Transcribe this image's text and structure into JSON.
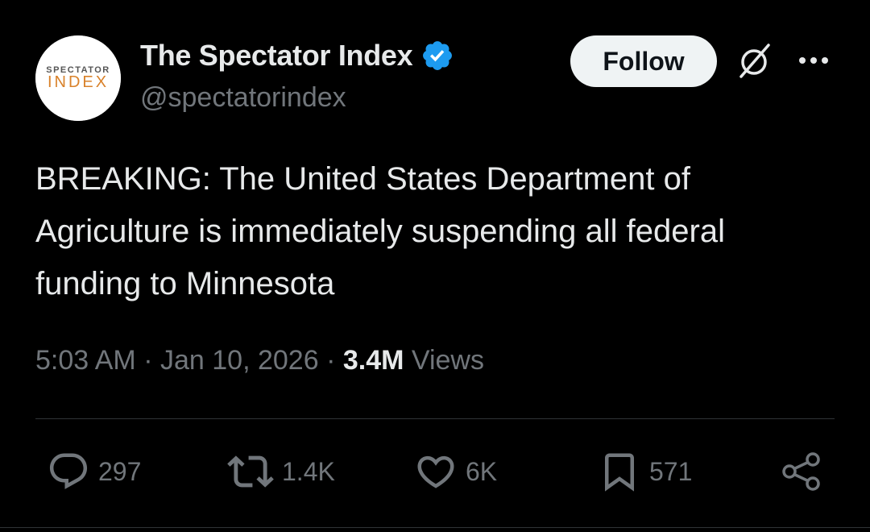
{
  "author": {
    "display_name": "The Spectator Index",
    "handle": "@spectatorindex",
    "verified": true,
    "avatar": {
      "line1": "SPECTATOR",
      "line2": "INDEX"
    }
  },
  "header_actions": {
    "follow_label": "Follow",
    "grok_icon": "grok-slash-icon",
    "more_icon": "more-dots-icon"
  },
  "tweet": {
    "text": "BREAKING: The United States Department of Agriculture is immediately suspending all federal funding to Minnesota",
    "time": "5:03 AM",
    "separator": "·",
    "date": "Jan 10, 2026",
    "views_count": "3.4M",
    "views_label": "Views"
  },
  "actions": {
    "replies": "297",
    "reposts": "1.4K",
    "likes": "6K",
    "bookmarks": "571"
  },
  "colors": {
    "background": "#000000",
    "text_primary": "#e7e9ea",
    "text_secondary": "#71767b",
    "verified_blue": "#1d9bf0",
    "follow_bg": "#eff3f4",
    "avatar_orange": "#d9822b"
  }
}
